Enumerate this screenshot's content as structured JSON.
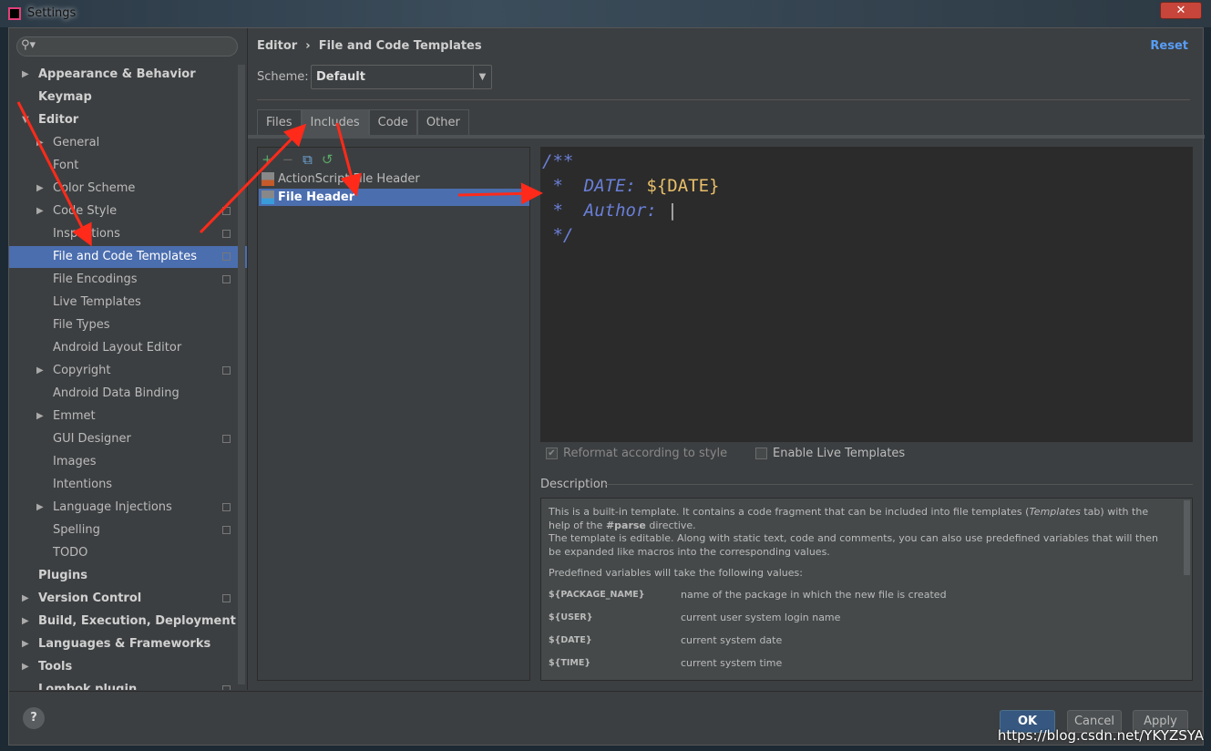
{
  "window": {
    "title": "Settings",
    "close": "✕"
  },
  "search": {
    "icon": "search-icon",
    "placeholder": ""
  },
  "sidebar": {
    "items": [
      {
        "label": "Appearance & Behavior",
        "level": 0,
        "bold": true,
        "arrow": "▶",
        "copy": false
      },
      {
        "label": "Keymap",
        "level": 0,
        "bold": true,
        "arrow": "",
        "copy": false
      },
      {
        "label": "Editor",
        "level": 0,
        "bold": true,
        "arrow": "▼",
        "copy": false
      },
      {
        "label": "General",
        "level": 1,
        "arrow": "▶",
        "copy": false
      },
      {
        "label": "Font",
        "level": 1,
        "arrow": "",
        "copy": false
      },
      {
        "label": "Color Scheme",
        "level": 1,
        "arrow": "▶",
        "copy": false
      },
      {
        "label": "Code Style",
        "level": 1,
        "arrow": "▶",
        "copy": true
      },
      {
        "label": "Inspections",
        "level": 1,
        "arrow": "",
        "copy": true
      },
      {
        "label": "File and Code Templates",
        "level": 1,
        "arrow": "",
        "copy": true,
        "selected": true
      },
      {
        "label": "File Encodings",
        "level": 1,
        "arrow": "",
        "copy": true
      },
      {
        "label": "Live Templates",
        "level": 1,
        "arrow": "",
        "copy": false
      },
      {
        "label": "File Types",
        "level": 1,
        "arrow": "",
        "copy": false
      },
      {
        "label": "Android Layout Editor",
        "level": 1,
        "arrow": "",
        "copy": false
      },
      {
        "label": "Copyright",
        "level": 1,
        "arrow": "▶",
        "copy": true
      },
      {
        "label": "Android Data Binding",
        "level": 1,
        "arrow": "",
        "copy": false
      },
      {
        "label": "Emmet",
        "level": 1,
        "arrow": "▶",
        "copy": false
      },
      {
        "label": "GUI Designer",
        "level": 1,
        "arrow": "",
        "copy": true
      },
      {
        "label": "Images",
        "level": 1,
        "arrow": "",
        "copy": false
      },
      {
        "label": "Intentions",
        "level": 1,
        "arrow": "",
        "copy": false
      },
      {
        "label": "Language Injections",
        "level": 1,
        "arrow": "▶",
        "copy": true
      },
      {
        "label": "Spelling",
        "level": 1,
        "arrow": "",
        "copy": true
      },
      {
        "label": "TODO",
        "level": 1,
        "arrow": "",
        "copy": false
      },
      {
        "label": "Plugins",
        "level": 0,
        "bold": true,
        "arrow": "",
        "copy": false
      },
      {
        "label": "Version Control",
        "level": 0,
        "bold": true,
        "arrow": "▶",
        "copy": true
      },
      {
        "label": "Build, Execution, Deployment",
        "level": 0,
        "bold": true,
        "arrow": "▶",
        "copy": false
      },
      {
        "label": "Languages & Frameworks",
        "level": 0,
        "bold": true,
        "arrow": "▶",
        "copy": false
      },
      {
        "label": "Tools",
        "level": 0,
        "bold": true,
        "arrow": "▶",
        "copy": false
      },
      {
        "label": "Lombok plugin",
        "level": 0,
        "bold": true,
        "arrow": "",
        "copy": true
      }
    ]
  },
  "header": {
    "breadcrumb_parent": "Editor",
    "breadcrumb_sep": "›",
    "breadcrumb_current": "File and Code Templates",
    "reset": "Reset"
  },
  "scheme": {
    "label": "Scheme:",
    "value": "Default"
  },
  "tabs": [
    {
      "label": "Files"
    },
    {
      "label": "Includes",
      "active": true
    },
    {
      "label": "Code"
    },
    {
      "label": "Other"
    }
  ],
  "toolbar": {
    "add": "+",
    "remove": "−",
    "copy": "copy-icon",
    "reset": "reset-icon"
  },
  "templates": [
    {
      "label": "ActionScript File Header",
      "icon": "AS"
    },
    {
      "label": "File Header",
      "icon": "J",
      "selected": true
    }
  ],
  "editor": {
    "line1": "/**",
    "line2_prefix": " *  DATE: ",
    "line2_var": "${DATE}",
    "line3": " *  Author: ",
    "line4": " */"
  },
  "options": {
    "reformat": "Reformat according to style",
    "reformat_checked": true,
    "live": "Enable Live Templates",
    "live_checked": false
  },
  "description": {
    "label": "Description",
    "p1a": "This is a built-in template. It contains a code fragment that can be included into file templates (",
    "p1b": "Templates",
    "p1c": " tab) with the help of the ",
    "p1d": "#parse",
    "p1e": " directive.",
    "p2": "The template is editable. Along with static text, code and comments, you can also use predefined variables that will then be expanded like macros into the corresponding values.",
    "p3": "Predefined variables will take the following values:",
    "vars": [
      {
        "name": "${PACKAGE_NAME}",
        "desc": "name of the package in which the new file is created"
      },
      {
        "name": "${USER}",
        "desc": "current user system login name"
      },
      {
        "name": "${DATE}",
        "desc": "current system date"
      },
      {
        "name": "${TIME}",
        "desc": "current system time"
      }
    ]
  },
  "buttons": {
    "help": "?",
    "ok": "OK",
    "cancel": "Cancel",
    "apply": "Apply"
  },
  "watermark": "https://blog.csdn.net/YKYZSYA",
  "colors": {
    "background": "#3c3f41",
    "editor": "#2b2b2b",
    "selection": "#4b6eaf",
    "link": "#589df6",
    "annotation": "#ff2a1a"
  }
}
